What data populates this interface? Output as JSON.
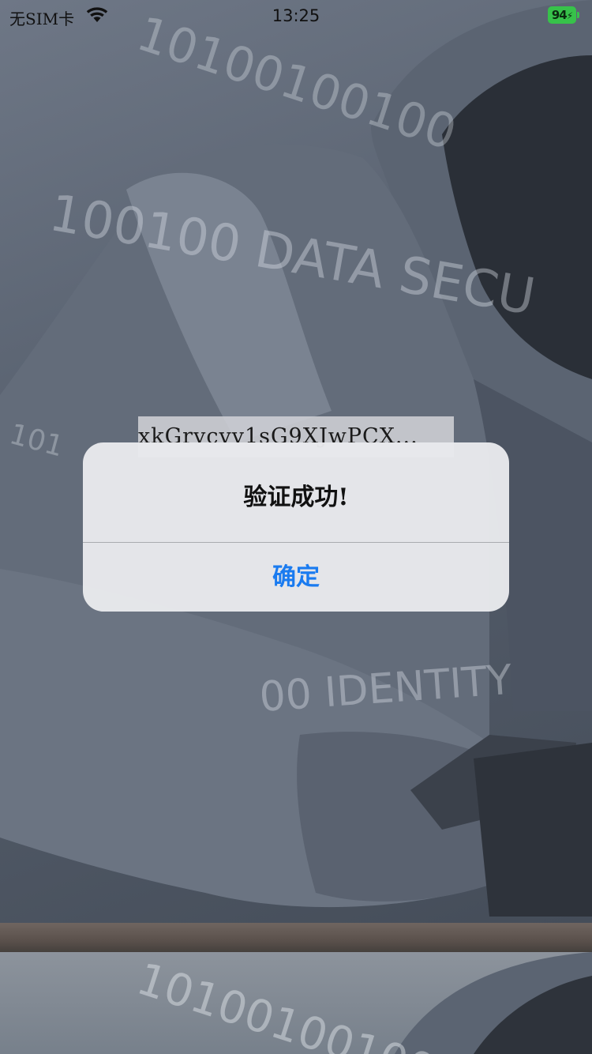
{
  "status_bar": {
    "carrier": "无SIM卡",
    "time": "13:25",
    "battery": "94"
  },
  "background": {
    "overlay_text_1": "10100100100",
    "overlay_text_2": "100100 DATA SECU",
    "overlay_text_3": "00 IDENTITY",
    "overlay_text_4": "101"
  },
  "token_label": {
    "text": "xkGrvcvv1sG9XJwPCX..."
  },
  "alert": {
    "title": "验证成功!",
    "confirm_label": "确定"
  },
  "colors": {
    "accent": "#1a7bf0",
    "battery": "#37c24a"
  }
}
